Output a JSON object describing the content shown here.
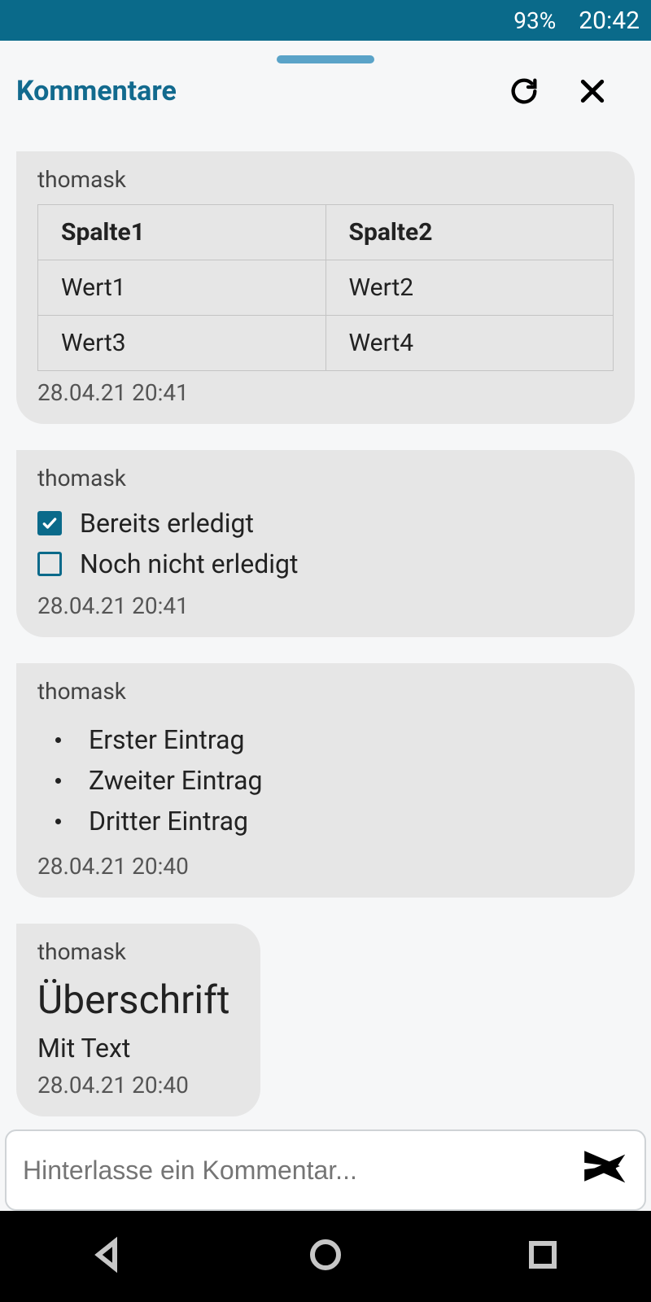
{
  "status": {
    "battery_pct": "93%",
    "clock": "20:42"
  },
  "header": {
    "title": "Kommentare"
  },
  "comments": [
    {
      "author": "thomask",
      "timestamp": "28.04.21 20:41",
      "table": {
        "headers": [
          "Spalte1",
          "Spalte2"
        ],
        "rows": [
          [
            "Wert1",
            "Wert2"
          ],
          [
            "Wert3",
            "Wert4"
          ]
        ]
      }
    },
    {
      "author": "thomask",
      "timestamp": "28.04.21 20:41",
      "checklist": [
        {
          "checked": true,
          "label": "Bereits erledigt"
        },
        {
          "checked": false,
          "label": "Noch nicht erledigt"
        }
      ]
    },
    {
      "author": "thomask",
      "timestamp": "28.04.21 20:40",
      "bullets": [
        "Erster Eintrag",
        "Zweiter Eintrag",
        "Dritter Eintrag"
      ]
    },
    {
      "author": "thomask",
      "timestamp": "28.04.21 20:40",
      "heading": "Überschrift",
      "body": "Mit Text"
    }
  ],
  "composer": {
    "placeholder": "Hinterlasse ein Kommentar..."
  }
}
